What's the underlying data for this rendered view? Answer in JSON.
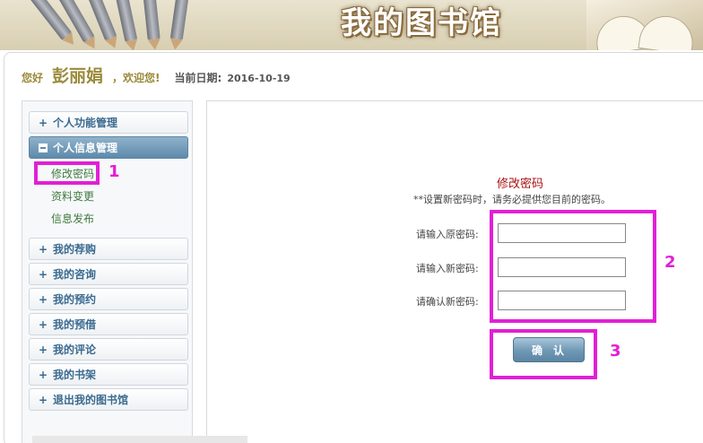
{
  "banner": {
    "title": "我的图书馆"
  },
  "greeting": {
    "hello": "您好",
    "name": "彭丽娟",
    "welcome": "，欢迎您!",
    "date_label": "当前日期:",
    "date": "2016-10-19"
  },
  "sidebar": {
    "items": [
      {
        "label": "个人功能管理",
        "expanded": false
      },
      {
        "label": "个人信息管理",
        "expanded": true,
        "children": [
          "修改密码",
          "资料变更",
          "信息发布"
        ]
      },
      {
        "label": "我的荐购",
        "expanded": false
      },
      {
        "label": "我的咨询",
        "expanded": false
      },
      {
        "label": "我的预约",
        "expanded": false
      },
      {
        "label": "我的预借",
        "expanded": false
      },
      {
        "label": "我的评论",
        "expanded": false
      },
      {
        "label": "我的书架",
        "expanded": false
      },
      {
        "label": "退出我的图书馆",
        "expanded": false
      }
    ]
  },
  "form": {
    "title": "修改密码",
    "hint": "**设置新密码时，请务必提供您目前的密码。",
    "fields": [
      {
        "label": "请输入原密码:",
        "value": ""
      },
      {
        "label": "请输入新密码:",
        "value": ""
      },
      {
        "label": "请确认新密码:",
        "value": ""
      }
    ],
    "confirm_label": "确认"
  },
  "annotations": {
    "label_1": "1",
    "label_2": "2",
    "label_3": "3",
    "color": "#e21fd6"
  },
  "colors": {
    "accent": "#5e8aab",
    "title_red": "#aa1111",
    "greeting": "#9a8a3a",
    "sub_link": "#3f7a3f"
  }
}
